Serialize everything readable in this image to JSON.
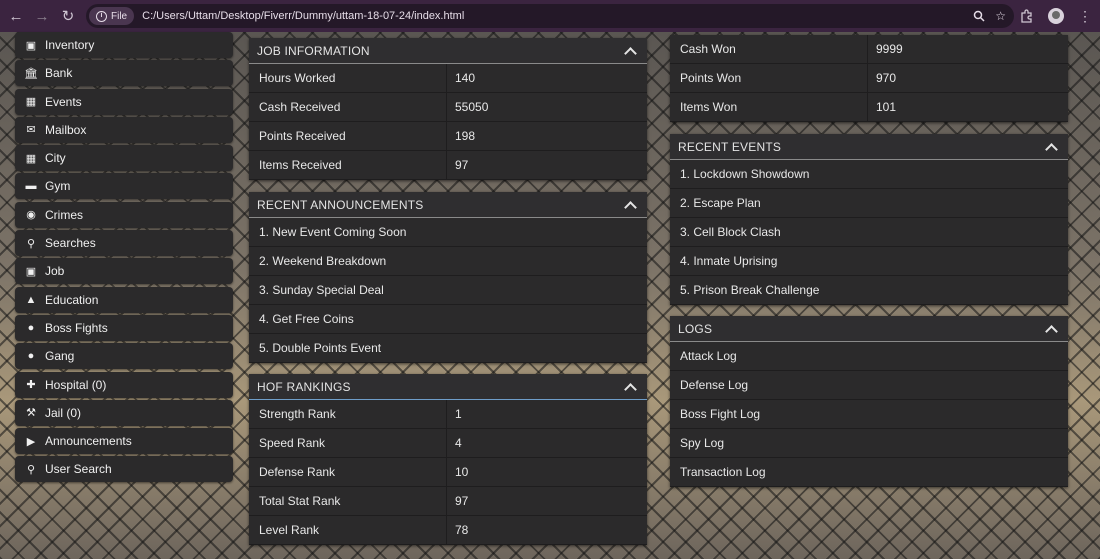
{
  "browser": {
    "file_chip": "File",
    "url": "C:/Users/Uttam/Desktop/Fiverr/Dummy/uttam-18-07-24/index.html"
  },
  "sidebar": {
    "items": [
      {
        "label": "Inventory",
        "icon": "inventory-icon"
      },
      {
        "label": "Bank",
        "icon": "bank-icon"
      },
      {
        "label": "Events",
        "icon": "calendar-icon"
      },
      {
        "label": "Mailbox",
        "icon": "mail-icon"
      },
      {
        "label": "City",
        "icon": "city-icon"
      },
      {
        "label": "Gym",
        "icon": "dumbbell-icon"
      },
      {
        "label": "Crimes",
        "icon": "mask-icon"
      },
      {
        "label": "Searches",
        "icon": "search-icon"
      },
      {
        "label": "Job",
        "icon": "briefcase-icon"
      },
      {
        "label": "Education",
        "icon": "graduation-cap-icon"
      },
      {
        "label": "Boss Fights",
        "icon": "user-secret-icon"
      },
      {
        "label": "Gang",
        "icon": "users-icon"
      },
      {
        "label": "Hospital (0)",
        "icon": "hospital-icon"
      },
      {
        "label": "Jail (0)",
        "icon": "gavel-icon"
      },
      {
        "label": "Announcements",
        "icon": "bullhorn-icon"
      },
      {
        "label": "User Search",
        "icon": "search-icon"
      }
    ]
  },
  "job_information": {
    "title": "JOB INFORMATION",
    "rows": [
      {
        "label": "Hours Worked",
        "value": "140"
      },
      {
        "label": "Cash Received",
        "value": "55050"
      },
      {
        "label": "Points Received",
        "value": "198"
      },
      {
        "label": "Items Received",
        "value": "97"
      }
    ]
  },
  "announcements": {
    "title": "RECENT ANNOUNCEMENTS",
    "items": [
      "1. New Event Coming Soon",
      "2. Weekend Breakdown",
      "3. Sunday Special Deal",
      "4. Get Free Coins",
      "5. Double Points Event"
    ]
  },
  "hof": {
    "title": "HOF RANKINGS",
    "rows": [
      {
        "label": "Strength Rank",
        "value": "1"
      },
      {
        "label": "Speed Rank",
        "value": "4"
      },
      {
        "label": "Defense Rank",
        "value": "10"
      },
      {
        "label": "Total Stat Rank",
        "value": "97"
      },
      {
        "label": "Level Rank",
        "value": "78"
      }
    ]
  },
  "won": {
    "rows": [
      {
        "label": "Cash Won",
        "value": "9999"
      },
      {
        "label": "Points Won",
        "value": "970"
      },
      {
        "label": "Items Won",
        "value": "101"
      }
    ]
  },
  "events": {
    "title": "RECENT EVENTS",
    "items": [
      "1. Lockdown Showdown",
      "2. Escape Plan",
      "3. Cell Block Clash",
      "4. Inmate Uprising",
      "5. Prison Break Challenge"
    ]
  },
  "logs": {
    "title": "LOGS",
    "items": [
      "Attack Log",
      "Defense Log",
      "Boss Fight Log",
      "Spy Log",
      "Transaction Log"
    ]
  },
  "colors": {
    "accent_border": "#6f9ec9",
    "panel_bg": "#2b2a2b",
    "browser_bar": "#3b2440"
  }
}
